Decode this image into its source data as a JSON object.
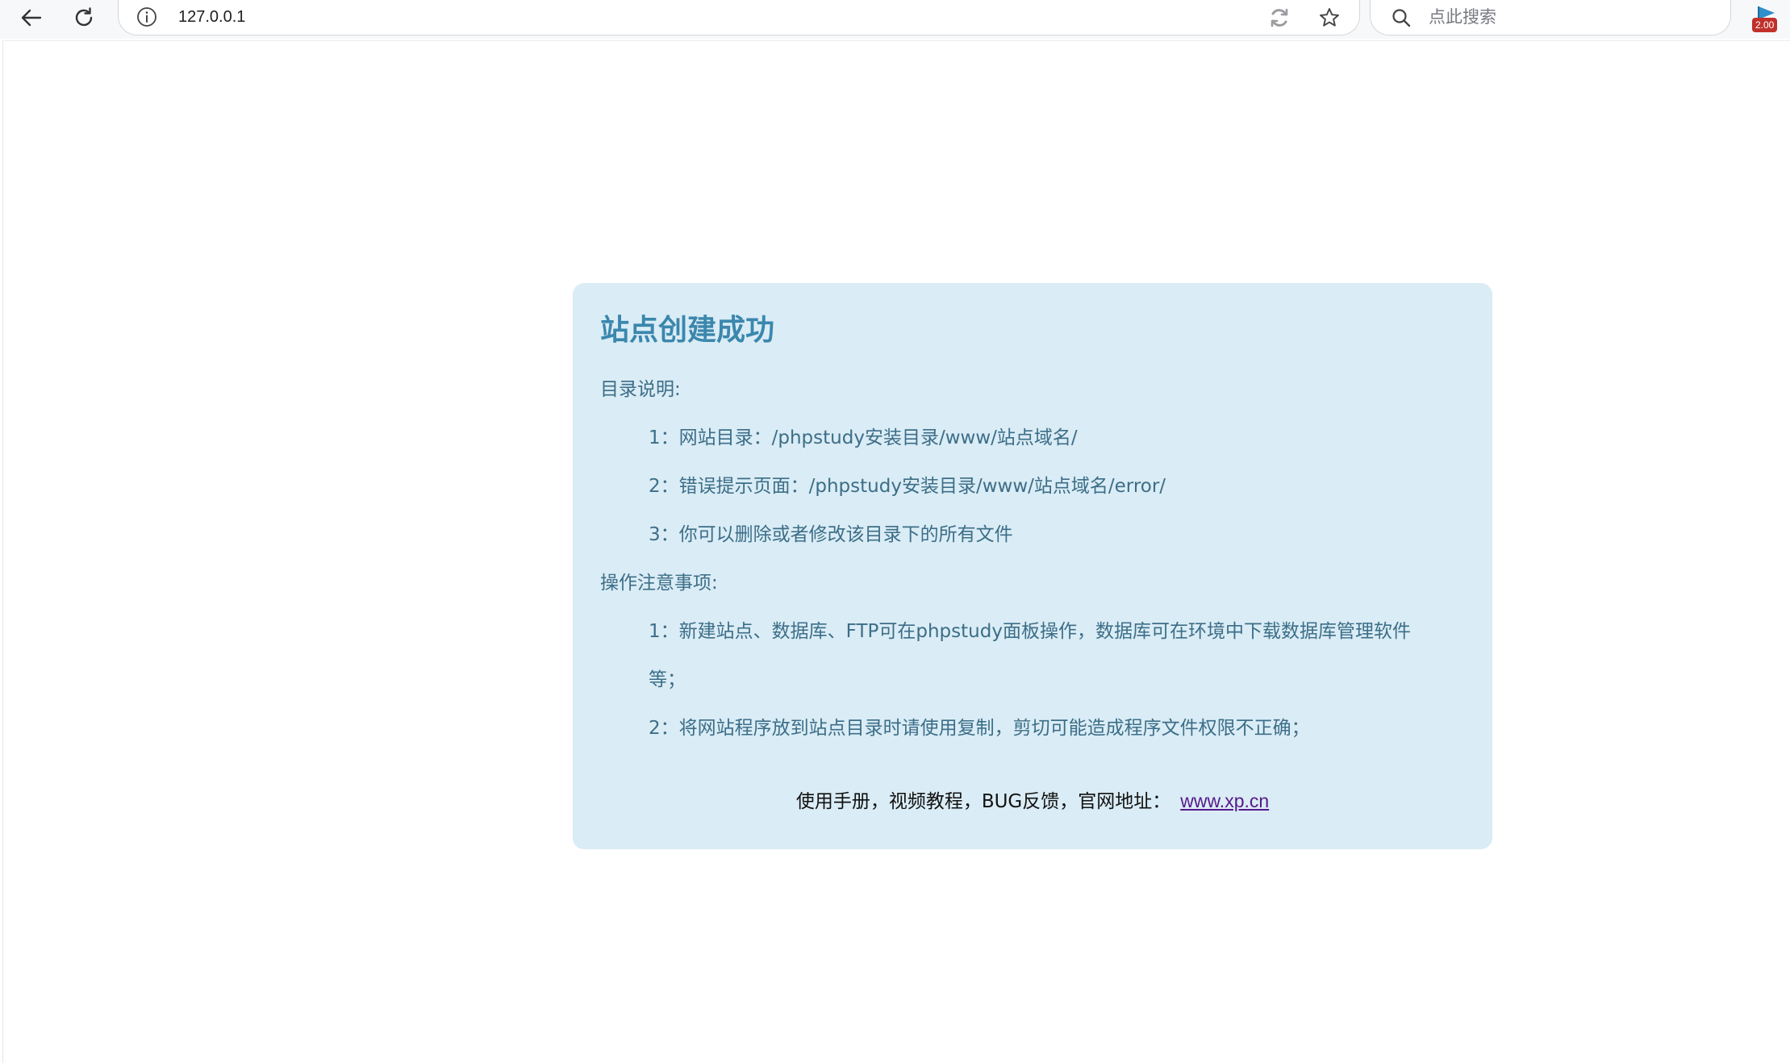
{
  "browser": {
    "url": "127.0.0.1",
    "search_placeholder": "点此搜索",
    "extension_badge": "2.00"
  },
  "page": {
    "title": "站点创建成功",
    "directory_heading": "目录说明:",
    "directory_items": [
      "1：网站目录：/phpstudy安装目录/www/站点域名/",
      "2：错误提示页面：/phpstudy安装目录/www/站点域名/error/",
      "3：你可以删除或者修改该目录下的所有文件"
    ],
    "notes_heading": "操作注意事项:",
    "notes_items": [
      "1：新建站点、数据库、FTP可在phpstudy面板操作，数据库可在环境中下载数据库管理软件",
      "等；",
      "2：将网站程序放到站点目录时请使用复制，剪切可能造成程序文件权限不正确；"
    ],
    "footer_text": "使用手册，视频教程，BUG反馈，官网地址：",
    "footer_link": "www.xp.cn"
  }
}
